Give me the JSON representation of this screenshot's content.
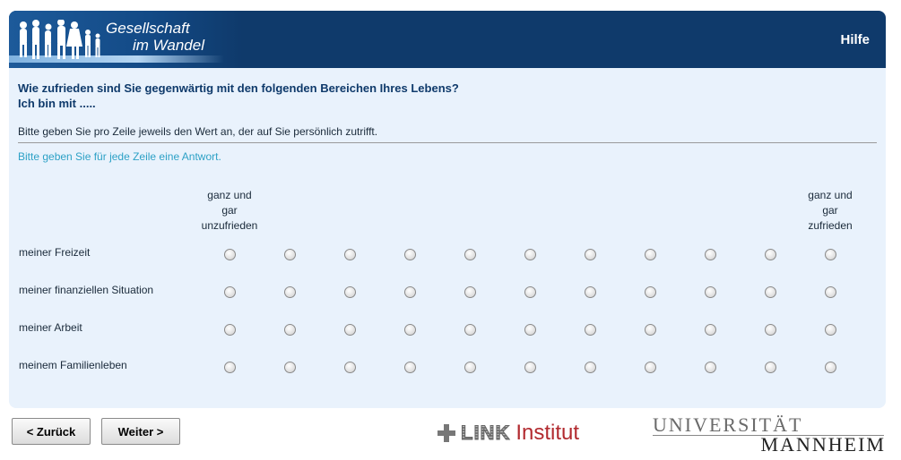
{
  "header": {
    "logo_line1": "Gesellschaft",
    "logo_line2": "im Wandel",
    "help_label": "Hilfe"
  },
  "question": {
    "title_line1": "Wie zufrieden sind Sie gegenwärtig mit den folgenden Bereichen Ihres Lebens?",
    "title_line2": "Ich bin mit .....",
    "instruction": "Bitte geben Sie pro Zeile jeweils den Wert an, der auf Sie persönlich zutrifft.",
    "warning": "Bitte geben Sie für jede Zeile eine Antwort."
  },
  "scale": {
    "left_label": [
      "ganz und",
      "gar",
      "unzufrieden"
    ],
    "right_label": [
      "ganz und",
      "gar",
      "zufrieden"
    ],
    "points": 11
  },
  "rows": [
    {
      "label": "meiner Freizeit"
    },
    {
      "label": "meiner finanziellen Situation"
    },
    {
      "label": "meiner Arbeit"
    },
    {
      "label": "meinem Familienleben"
    }
  ],
  "nav": {
    "back_label": "< Zurück",
    "next_label": "Weiter >"
  },
  "footer": {
    "link_word": "LINK",
    "link_institut": "Institut",
    "uni_line1": "UNIVERSITÄT",
    "uni_line2": "MANNHEIM"
  },
  "colors": {
    "header_bg": "#0f3a6b",
    "panel_bg": "#e9f2fc",
    "warning_text": "#2da1c6",
    "link_red": "#b22a2f"
  }
}
